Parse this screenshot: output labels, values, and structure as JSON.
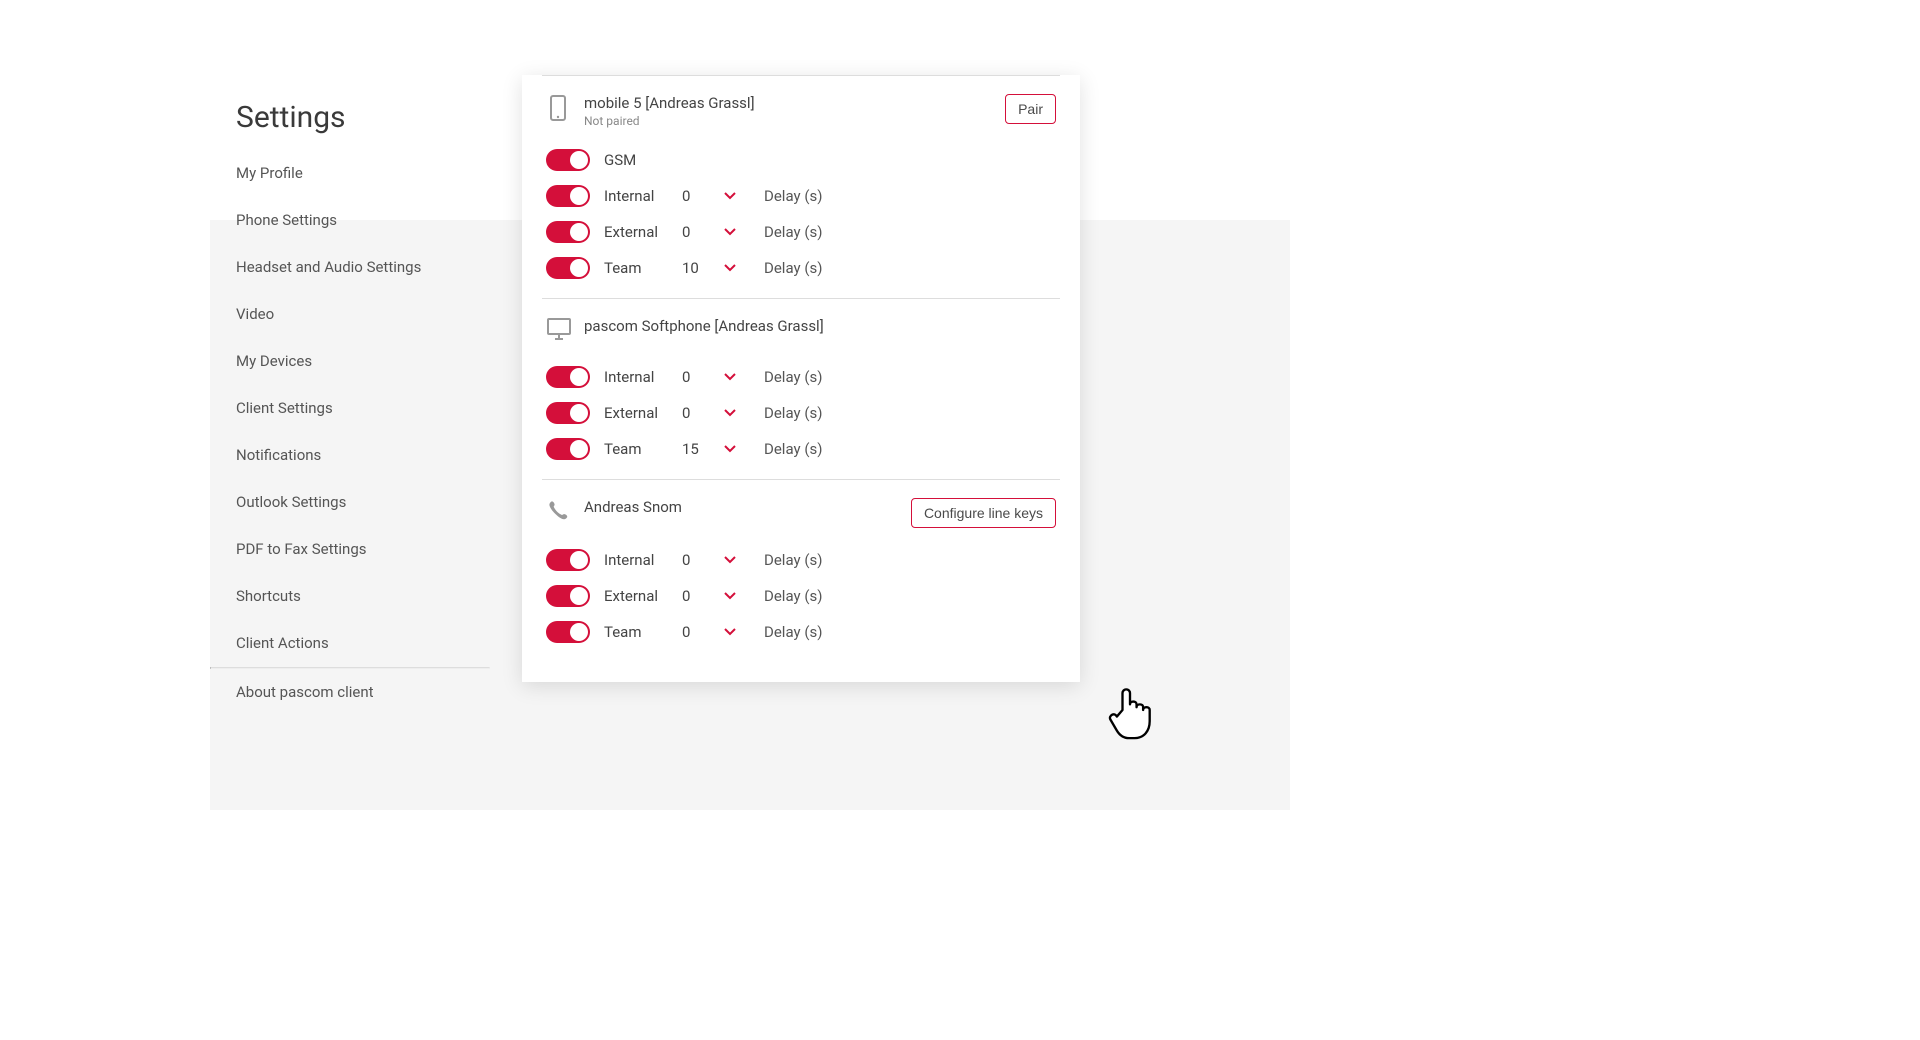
{
  "page": {
    "title": "Settings"
  },
  "sidebar": {
    "items": [
      "My Profile",
      "Phone Settings",
      "Headset and Audio Settings",
      "Video",
      "My Devices",
      "Client Settings",
      "Notifications",
      "Outlook Settings",
      "PDF to Fax Settings",
      "Shortcuts",
      "Client Actions",
      "About pascom client"
    ]
  },
  "labels": {
    "delay_unit": "Delay (s)",
    "gsm": "GSM",
    "internal": "Internal",
    "external": "External",
    "team": "Team",
    "pair": "Pair",
    "configure_line_keys": "Configure line keys"
  },
  "devices": [
    {
      "title": "mobile 5 [Andreas Grassl]",
      "subtitle": "Not paired",
      "action": "pair",
      "rows": [
        {
          "kind": "gsm"
        },
        {
          "kind": "internal",
          "value": "0"
        },
        {
          "kind": "external",
          "value": "0"
        },
        {
          "kind": "team",
          "value": "10"
        }
      ]
    },
    {
      "title": "pascom Softphone [Andreas Grassl]",
      "rows": [
        {
          "kind": "internal",
          "value": "0"
        },
        {
          "kind": "external",
          "value": "0"
        },
        {
          "kind": "team",
          "value": "15"
        }
      ]
    },
    {
      "title": "Andreas Snom",
      "action": "configure",
      "rows": [
        {
          "kind": "internal",
          "value": "0"
        },
        {
          "kind": "external",
          "value": "0"
        },
        {
          "kind": "team",
          "value": "0"
        }
      ]
    }
  ]
}
